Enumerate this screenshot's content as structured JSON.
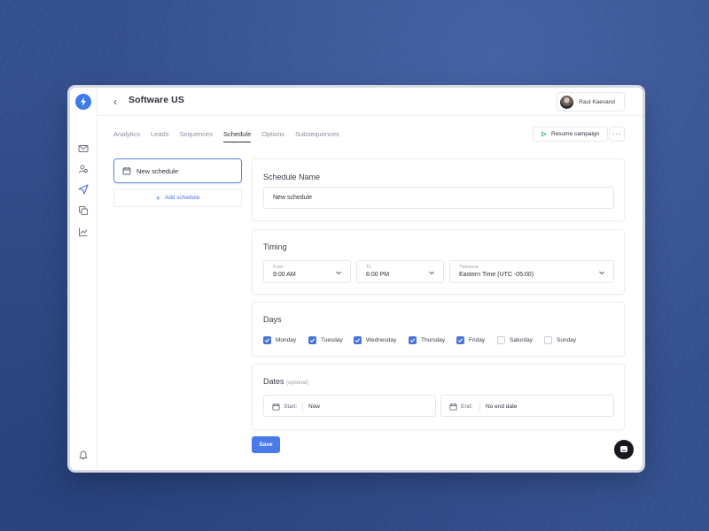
{
  "app": {
    "title": "Software US",
    "back_glyph": "‹",
    "user_name": "Raul Kaevand",
    "brand_color": "#3f7be6"
  },
  "rail": {
    "icons": [
      "logo-bolt-icon",
      "mail-icon",
      "leads-icon",
      "send-icon",
      "copy-icon",
      "analytics-icon",
      "bell-icon"
    ]
  },
  "tabs": [
    {
      "label": "Analytics",
      "active": false
    },
    {
      "label": "Leads",
      "active": false
    },
    {
      "label": "Sequences",
      "active": false
    },
    {
      "label": "Schedule",
      "active": true
    },
    {
      "label": "Options",
      "active": false
    },
    {
      "label": "Subsequences",
      "active": false
    }
  ],
  "actions": {
    "resume_label": "Resume campaign",
    "more_glyph": "···"
  },
  "sidebar": {
    "schedule_item": "New schedule",
    "add_label": "Add schedule",
    "add_glyph": "+"
  },
  "schedule_name": {
    "title": "Schedule Name",
    "value": "New schedule"
  },
  "timing": {
    "title": "Timing",
    "from_label": "From",
    "from_value": "9:00 AM",
    "to_label": "To",
    "to_value": "6:00 PM",
    "tz_label": "Timezone",
    "tz_value": "Eastern Time (UTC -05:00)"
  },
  "days": {
    "title": "Days",
    "items": [
      {
        "label": "Monday",
        "checked": true
      },
      {
        "label": "Tuesday",
        "checked": true
      },
      {
        "label": "Wednesday",
        "checked": true
      },
      {
        "label": "Thursday",
        "checked": true
      },
      {
        "label": "Friday",
        "checked": true
      },
      {
        "label": "Saturday",
        "checked": false
      },
      {
        "label": "Sunday",
        "checked": false
      }
    ]
  },
  "dates": {
    "title": "Dates",
    "optional": "(optional)",
    "start_label": "Start:",
    "start_value": "Now",
    "end_label": "End:",
    "end_value": "No end date"
  },
  "footer": {
    "save_label": "Save"
  }
}
